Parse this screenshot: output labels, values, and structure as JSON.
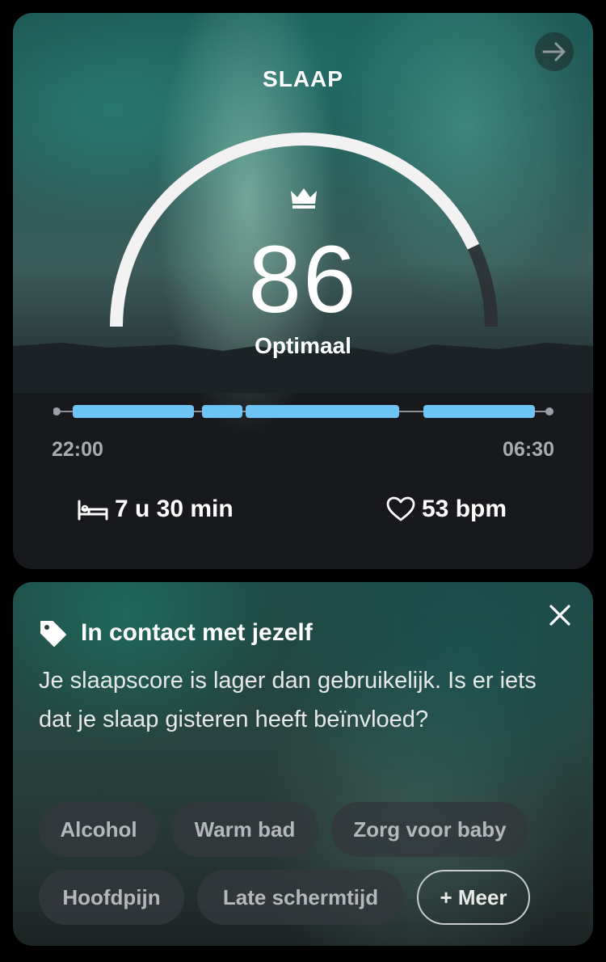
{
  "sleep": {
    "title": "SLAAP",
    "score": "86",
    "rating": "Optimaal",
    "score_fraction": 0.86,
    "timeline": {
      "start": "22:00",
      "end": "06:30",
      "color": "#6ec3f5"
    },
    "duration": "7 u 30 min",
    "heart_rate": "53 bpm",
    "icons": [
      "arrow-right-icon",
      "crown-icon",
      "bed-icon",
      "heart-icon"
    ]
  },
  "prompt": {
    "title": "In contact met jezelf",
    "body": "Je slaapscore is lager dan gebruikelijk. Is er iets dat je slaap gisteren heeft beïnvloed?",
    "chips": [
      "Alcohol",
      "Warm bad",
      "Zorg voor baby",
      "Hoofdpijn",
      "Late schermtijd"
    ],
    "more_label": "+ Meer",
    "icons": [
      "tag-icon",
      "close-icon"
    ]
  }
}
